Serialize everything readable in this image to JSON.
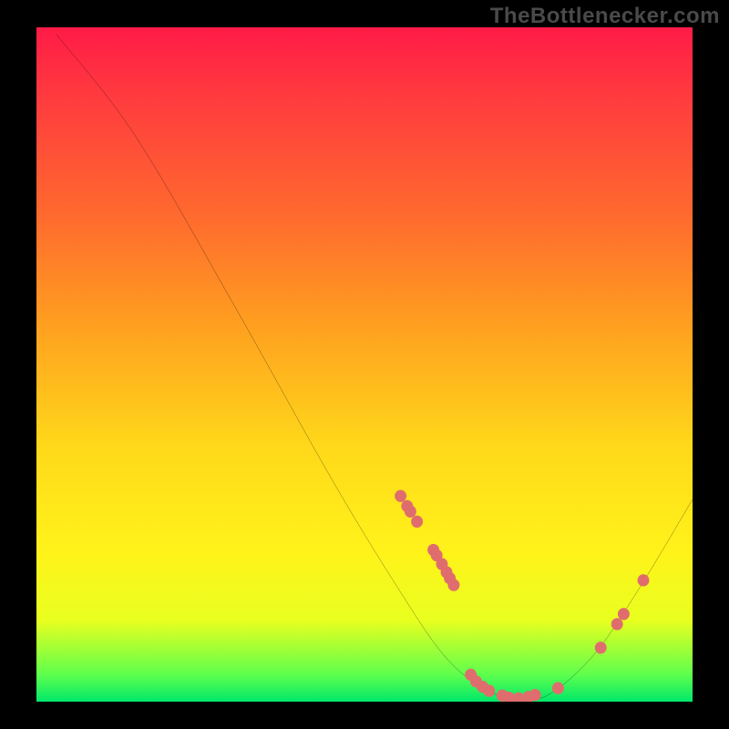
{
  "watermark": "TheBottlenecker.com",
  "chart_data": {
    "type": "line",
    "title": "",
    "xlabel": "",
    "ylabel": "",
    "xlim": [
      0,
      100
    ],
    "ylim": [
      0,
      100
    ],
    "series": [
      {
        "name": "curve",
        "points": [
          {
            "x": 3,
            "y": 99
          },
          {
            "x": 15,
            "y": 84
          },
          {
            "x": 30,
            "y": 59
          },
          {
            "x": 45,
            "y": 33
          },
          {
            "x": 55,
            "y": 17
          },
          {
            "x": 62,
            "y": 7
          },
          {
            "x": 68,
            "y": 2
          },
          {
            "x": 73,
            "y": 0.5
          },
          {
            "x": 78,
            "y": 1
          },
          {
            "x": 85,
            "y": 7
          },
          {
            "x": 92,
            "y": 17
          },
          {
            "x": 100,
            "y": 30
          }
        ]
      }
    ],
    "markers": [
      {
        "x": 55.5,
        "y": 30.5
      },
      {
        "x": 56.5,
        "y": 29.0
      },
      {
        "x": 57.0,
        "y": 28.2
      },
      {
        "x": 58.0,
        "y": 26.7
      },
      {
        "x": 60.5,
        "y": 22.5
      },
      {
        "x": 61.0,
        "y": 21.7
      },
      {
        "x": 61.8,
        "y": 20.4
      },
      {
        "x": 62.5,
        "y": 19.2
      },
      {
        "x": 63.0,
        "y": 18.3
      },
      {
        "x": 63.6,
        "y": 17.3
      },
      {
        "x": 66.2,
        "y": 4.0
      },
      {
        "x": 67.0,
        "y": 3.0
      },
      {
        "x": 68.0,
        "y": 2.2
      },
      {
        "x": 69.0,
        "y": 1.6
      },
      {
        "x": 71.0,
        "y": 0.9
      },
      {
        "x": 72.0,
        "y": 0.6
      },
      {
        "x": 73.5,
        "y": 0.5
      },
      {
        "x": 75.0,
        "y": 0.7
      },
      {
        "x": 76.0,
        "y": 1.0
      },
      {
        "x": 79.5,
        "y": 2.0
      },
      {
        "x": 86.0,
        "y": 8.0
      },
      {
        "x": 88.5,
        "y": 11.5
      },
      {
        "x": 89.5,
        "y": 13.0
      },
      {
        "x": 92.5,
        "y": 18.0
      }
    ],
    "gradient_stops": [
      {
        "pos": 0,
        "color": "#ff1b46"
      },
      {
        "pos": 28,
        "color": "#ff6a2e"
      },
      {
        "pos": 62,
        "color": "#ffd81a"
      },
      {
        "pos": 88,
        "color": "#e8ff1f"
      },
      {
        "pos": 100,
        "color": "#00e86a"
      }
    ]
  }
}
